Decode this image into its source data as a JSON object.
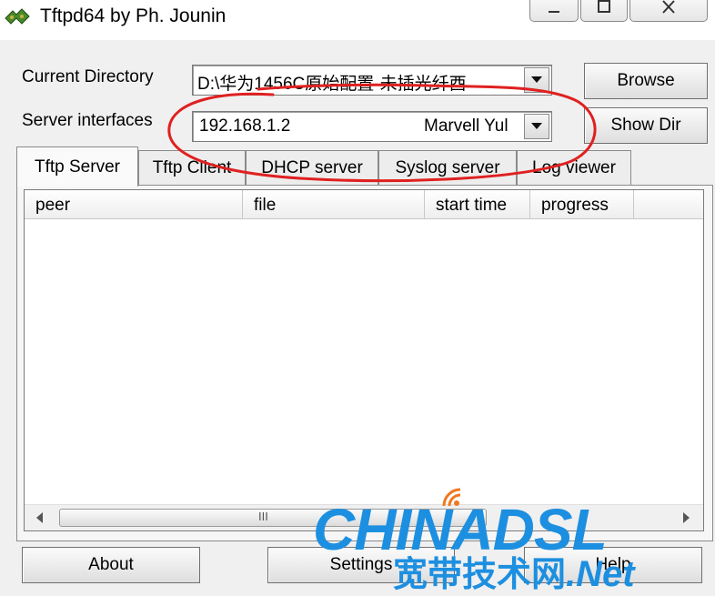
{
  "window": {
    "title": "Tftpd64 by Ph. Jounin"
  },
  "form": {
    "current_directory_label": "Current Directory",
    "current_directory_value": "D:\\华为1456C原始配置-未插光纤酉",
    "server_interfaces_label": "Server interfaces",
    "server_interface_ip": "192.168.1.2",
    "server_interface_adapter": "Marvell Yul",
    "browse_label": "Browse",
    "show_dir_label": "Show Dir"
  },
  "tabs": [
    {
      "label": "Tftp Server",
      "active": true
    },
    {
      "label": "Tftp Client",
      "active": false
    },
    {
      "label": "DHCP server",
      "active": false
    },
    {
      "label": "Syslog server",
      "active": false
    },
    {
      "label": "Log viewer",
      "active": false
    }
  ],
  "table": {
    "columns": [
      "peer",
      "file",
      "start time",
      "progress"
    ],
    "rows": []
  },
  "scrollbar": {
    "grip": "III"
  },
  "footer": {
    "about_label": "About",
    "settings_label": "Settings",
    "help_label": "Help"
  },
  "watermark": {
    "brand": "CHINADSL",
    "subtitle": "宽带技术网",
    "suffix": ".Net"
  },
  "colors": {
    "annotation": "#e02020",
    "watermark": "#1d8fe0",
    "watermark_dot": "#f07820"
  }
}
